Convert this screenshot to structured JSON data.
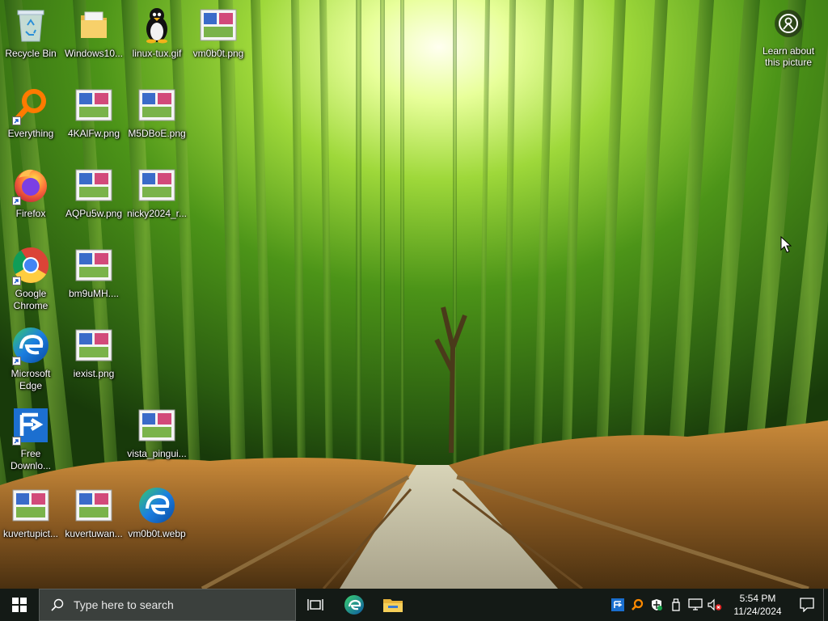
{
  "desktop": {
    "icons": [
      {
        "label": "Recycle Bin",
        "icon": "recycle-bin-icon"
      },
      {
        "label": "Windows10...",
        "icon": "folder-icon"
      },
      {
        "label": "linux-tux.gif",
        "icon": "tux-image-icon"
      },
      {
        "label": "vm0b0t.png",
        "icon": "image-thumbnail-icon"
      },
      {
        "label": "Everything",
        "icon": "everything-search-icon"
      },
      {
        "label": "4KAlFw.png",
        "icon": "image-thumbnail-icon"
      },
      {
        "label": "M5DBoE.png",
        "icon": "image-thumbnail-icon"
      },
      {
        "label": "Firefox",
        "icon": "firefox-icon"
      },
      {
        "label": "AQPu5w.png",
        "icon": "image-thumbnail-icon"
      },
      {
        "label": "nicky2024_r...",
        "icon": "image-thumbnail-icon"
      },
      {
        "label": "Google Chrome",
        "icon": "chrome-icon"
      },
      {
        "label": "bm9uMH....",
        "icon": "image-thumbnail-icon"
      },
      {
        "label": "Microsoft Edge",
        "icon": "edge-icon"
      },
      {
        "label": "iexist.png",
        "icon": "image-thumbnail-icon"
      },
      {
        "label": "Free Downlo...",
        "icon": "free-download-manager-icon"
      },
      {
        "label": "vista_pingui...",
        "icon": "image-thumbnail-icon"
      },
      {
        "label": "kuvertupict...",
        "icon": "image-thumbnail-icon"
      },
      {
        "label": "kuvertuwan...",
        "icon": "image-thumbnail-icon"
      },
      {
        "label": "vm0b0t.webp",
        "icon": "edge-webp-icon"
      }
    ],
    "learn_about": "Learn about this picture"
  },
  "taskbar": {
    "search_placeholder": "Type here to search",
    "pinned": [
      "task-view-icon",
      "edge-icon",
      "file-explorer-icon"
    ],
    "tray_icons": [
      "fdm-tray-icon",
      "everything-tray-icon",
      "defender-tray-icon",
      "usb-tray-icon",
      "network-tray-icon",
      "volume-muted-icon"
    ],
    "time": "5:54 PM",
    "date": "11/24/2024"
  },
  "colors": {
    "taskbar": "#141a16",
    "search_box": "#3b403d",
    "accent_edge": "#1c7ee0"
  }
}
